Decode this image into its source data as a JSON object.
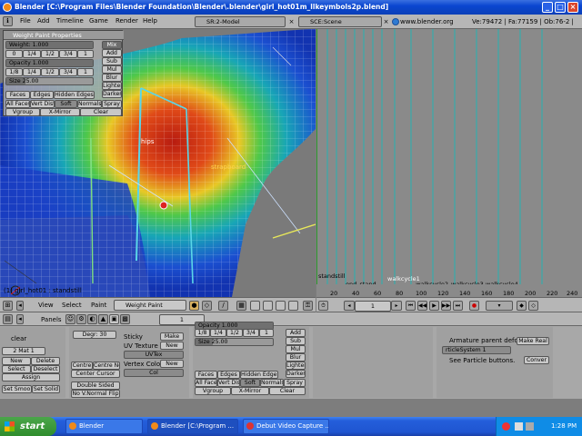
{
  "window": {
    "title": "Blender [C:\\Program Files\\Blender Foundation\\Blender\\.blender\\girl_hot01m_llkeymbols2p.blend]",
    "controls": [
      "_",
      "□",
      "×"
    ]
  },
  "menubar": {
    "items": [
      "File",
      "Add",
      "Timeline",
      "Game",
      "Render",
      "Help"
    ],
    "screen_field": "SR:2-Model",
    "scene_field": "SCE:Scene",
    "url": "www.blender.org 249.2",
    "stats": "Ve:79472 | Fa:77159 | Ob:76-2 |"
  },
  "weight_panel": {
    "title": "Weight Paint Properties",
    "weight_label": "Weight: 1.000",
    "weight_value": 1.0,
    "weight_presets": [
      "0",
      "1/4",
      "1/2",
      "3/4",
      "1"
    ],
    "opacity_label": "Opacity 1.000",
    "opacity_value": 1.0,
    "opacity_presets": [
      "1/8",
      "1/4",
      "1/2",
      "3/4",
      "1"
    ],
    "size_label": "Size 25.00",
    "modes": [
      "Mix",
      "Add",
      "Sub",
      "Mul",
      "Blur",
      "Lighter",
      "Darker"
    ],
    "row1": [
      "Faces",
      "Edges",
      "Hidden Edges"
    ],
    "row2": [
      "All Faces",
      "Vert Dist",
      "Soft",
      "Normals",
      "Spray"
    ],
    "row3": [
      "Vgroup",
      "X-Mirror",
      "Clear"
    ]
  },
  "viewport": {
    "labels": {
      "hips": "hips",
      "info": "(1) girl_hot01 : standstill",
      "scap": "strapboard"
    }
  },
  "header3d": {
    "view": "View",
    "select": "Select",
    "paint": "Paint",
    "mode": "Weight Paint"
  },
  "timeline": {
    "markers": [
      "standstill",
      "end_stand",
      "walkcycle1",
      "_walkcycle2",
      "walkcycle3",
      "walkcycle4"
    ],
    "ticks": [
      "20",
      "40",
      "60",
      "80",
      "100",
      "120",
      "140",
      "160",
      "180",
      "200",
      "220",
      "240"
    ],
    "frame": "1"
  },
  "buttons": {
    "panels_label": "Panels",
    "page_value": "1",
    "link_mat": "2 Mat 1",
    "mat_buttons": [
      "New",
      "Delete",
      "Select",
      "Deselect",
      "Assign"
    ],
    "set_buttons": [
      "Set Smoo",
      "Set Solid"
    ],
    "clear_label": "clear",
    "degr": "Degr: 30",
    "centre_buttons": [
      "Centre",
      "Centre Ne",
      "Center Cursor"
    ],
    "double_sided": "Double Sided",
    "no_vnormal": "No V.Normal Flip",
    "sticky": "Sticky",
    "make": "Make",
    "uvtex": "UV Texture",
    "uvtex_new": "New",
    "uvtex_name": "UVTex",
    "vcol": "Vertex Color",
    "vcol_new": "New",
    "vcol_name": "Col",
    "modifiers": {
      "armature_label": "Armature parent deform",
      "make_real": "Make Real",
      "psys": "rticleSystem 1",
      "see": "See Particle buttons.",
      "convert": "Conver"
    }
  },
  "taskbar": {
    "start": "start",
    "tasks": [
      "Blender",
      "Blender [C:\\Program ...",
      "Debut Video Capture ..."
    ],
    "clock": "1:28 PM"
  }
}
